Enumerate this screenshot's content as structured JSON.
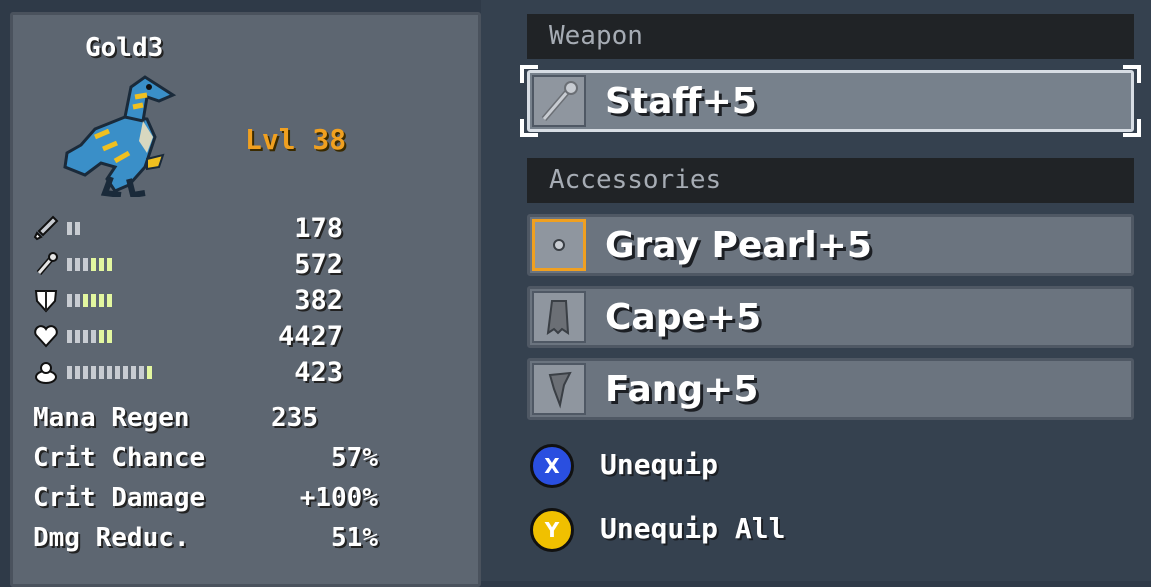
{
  "character": {
    "name": "Gold3",
    "level": "Lvl 38"
  },
  "stats": [
    {
      "icon": "sword-icon",
      "value": "178",
      "pips": 2,
      "hi_pips": 0
    },
    {
      "icon": "staff-icon",
      "value": "572",
      "pips": 6,
      "hi_pips": 3
    },
    {
      "icon": "shield-icon",
      "value": "382",
      "pips": 6,
      "hi_pips": 4
    },
    {
      "icon": "heart-icon",
      "value": "4427",
      "pips": 6,
      "hi_pips": 2
    },
    {
      "icon": "mana-drop-icon",
      "value": "423",
      "pips": 11,
      "hi_pips": 1
    }
  ],
  "derived_stats": [
    {
      "label": "Mana Regen",
      "value": "235"
    },
    {
      "label": "Crit Chance",
      "value": "57%"
    },
    {
      "label": "Crit Damage",
      "value": "+100%"
    },
    {
      "label": "Dmg Reduc.",
      "value": "51%"
    }
  ],
  "equipment": {
    "weapon_header": "Weapon",
    "weapon": {
      "label": "Staff+5",
      "icon": "staff-icon"
    },
    "accessories_header": "Accessories",
    "accessories": [
      {
        "label": "Gray Pearl+5",
        "icon": "pearl-icon"
      },
      {
        "label": "Cape+5",
        "icon": "cape-icon"
      },
      {
        "label": "Fang+5",
        "icon": "fang-icon"
      }
    ]
  },
  "actions": [
    {
      "button": "X",
      "label": "Unequip",
      "color": "#2a4fe0"
    },
    {
      "button": "Y",
      "label": "Unequip All",
      "color": "#f0c000"
    }
  ],
  "colors": {
    "level": "#f0a020",
    "focus": "#f0a020",
    "pip_high": "#e3f7a0"
  }
}
